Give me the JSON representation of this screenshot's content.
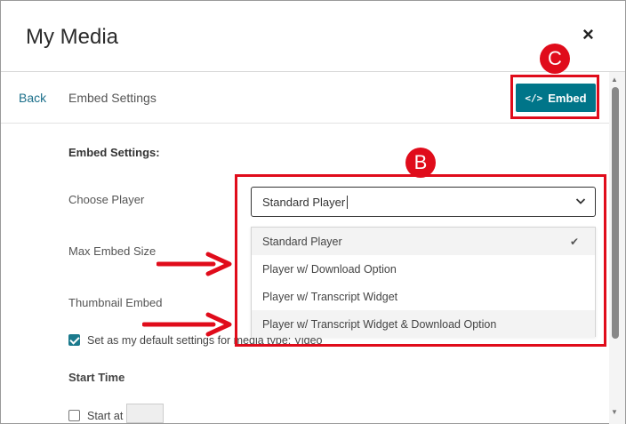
{
  "modal": {
    "title": "My Media",
    "close_label": "×"
  },
  "nav": {
    "back_label": "Back",
    "title": "Embed Settings",
    "embed_button_label": "Embed"
  },
  "form": {
    "section_label": "Embed Settings:",
    "choose_player_label": "Choose Player",
    "max_embed_size_label": "Max Embed Size",
    "thumbnail_embed_label": "Thumbnail Embed",
    "default_settings_label": "Set as my default settings for media type: Video",
    "default_settings_checked": true,
    "start_time_label": "Start Time",
    "start_at_label": "Start at",
    "start_at_checked": false
  },
  "player_select": {
    "value": "Standard Player",
    "options": [
      {
        "label": "Standard Player",
        "selected": true
      },
      {
        "label": "Player w/ Download Option",
        "selected": false
      },
      {
        "label": "Player w/ Transcript Widget",
        "selected": false
      },
      {
        "label": "Player w/ Transcript Widget & Download Option",
        "selected": false
      }
    ]
  },
  "annotations": {
    "badge_b": "B",
    "badge_c": "C",
    "accent_red": "#e00c1b"
  },
  "colors": {
    "primary_button": "#007589",
    "link": "#1b6f8a"
  }
}
